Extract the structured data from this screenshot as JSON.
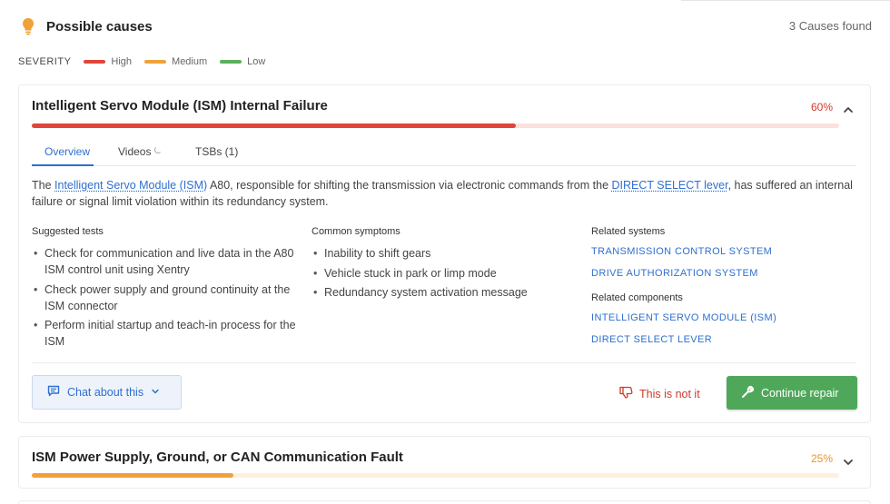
{
  "header": {
    "title": "Possible causes",
    "count": "3 Causes found"
  },
  "severity": {
    "label": "SEVERITY",
    "levels": [
      {
        "label": "High",
        "color": "#e0453a"
      },
      {
        "label": "Medium",
        "color": "#f0a23a"
      },
      {
        "label": "Low",
        "color": "#5cb05f"
      }
    ]
  },
  "causes": [
    {
      "title": "Intelligent Servo Module (ISM) Internal Failure",
      "percent": "60%",
      "likelihood": 0.6,
      "color": "#e0453a",
      "track_color": "#fbe0de",
      "expanded": true,
      "tabs": [
        {
          "label": "Overview",
          "active": true
        },
        {
          "label": "Videos",
          "active": false
        },
        {
          "label": "TSBs (1)",
          "active": false
        }
      ],
      "description": {
        "pre": "The ",
        "link1": "Intelligent Servo Module (ISM)",
        "mid": " A80, responsible for shifting the transmission via electronic commands from the ",
        "link2": "DIRECT SELECT lever",
        "post": ", has suffered an internal failure or signal limit violation within its redundancy system."
      },
      "suggested_tests": {
        "title": "Suggested tests",
        "items": [
          "Check for communication and live data in the A80 ISM control unit using Xentry",
          "Check power supply and ground continuity at the ISM connector",
          "Perform initial startup and teach-in process for the ISM"
        ]
      },
      "common_symptoms": {
        "title": "Common symptoms",
        "items": [
          "Inability to shift gears",
          "Vehicle stuck in park or limp mode",
          "Redundancy system activation message"
        ]
      },
      "related_systems": {
        "title": "Related systems",
        "items": [
          "TRANSMISSION CONTROL SYSTEM",
          "DRIVE AUTHORIZATION SYSTEM"
        ]
      },
      "related_components": {
        "title": "Related components",
        "items": [
          "INTELLIGENT SERVO MODULE (ISM)",
          "DIRECT SELECT LEVER"
        ]
      },
      "actions": {
        "chat": "Chat about this",
        "not_it": "This is not it",
        "continue": "Continue repair"
      }
    },
    {
      "title": "ISM Power Supply, Ground, or CAN Communication Fault",
      "percent": "25%",
      "likelihood": 0.25,
      "color": "#f0a23a",
      "track_color": "#fdf0dd",
      "expanded": false
    }
  ],
  "colors": {
    "accent": "#2f6fcf",
    "danger": "#d0392b",
    "success": "#4fa85a",
    "bulb": "#f0a23a"
  }
}
